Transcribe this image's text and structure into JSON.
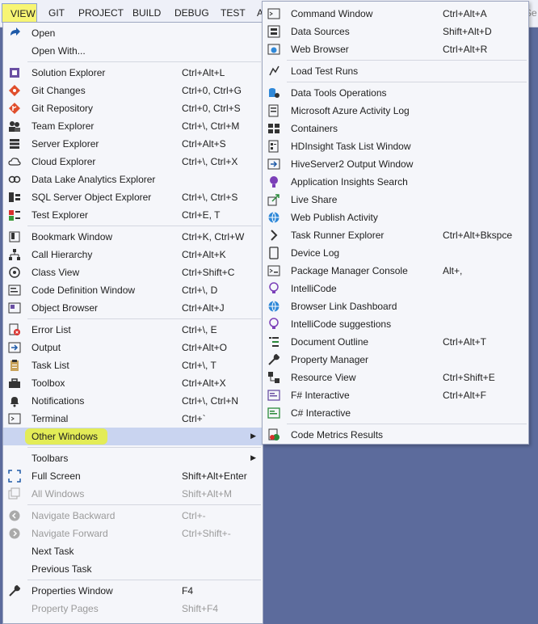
{
  "menubar": {
    "items": [
      "VIEW",
      "GIT",
      "PROJECT",
      "BUILD",
      "DEBUG",
      "TEST",
      "A"
    ],
    "search_hint": "Se"
  },
  "view_menu": {
    "items": [
      {
        "label": "Open",
        "shortcut": "",
        "icon": "open-icon"
      },
      {
        "label": "Open With...",
        "shortcut": ""
      },
      {
        "label": "Solution Explorer",
        "shortcut": "Ctrl+Alt+L",
        "icon": "solution-explorer-icon"
      },
      {
        "label": "Git Changes",
        "shortcut": "Ctrl+0, Ctrl+G",
        "icon": "git-changes-icon"
      },
      {
        "label": "Git Repository",
        "shortcut": "Ctrl+0, Ctrl+S",
        "icon": "git-repository-icon"
      },
      {
        "label": "Team Explorer",
        "shortcut": "Ctrl+\\, Ctrl+M",
        "icon": "team-explorer-icon"
      },
      {
        "label": "Server Explorer",
        "shortcut": "Ctrl+Alt+S",
        "icon": "server-explorer-icon"
      },
      {
        "label": "Cloud Explorer",
        "shortcut": "Ctrl+\\, Ctrl+X",
        "icon": "cloud-icon"
      },
      {
        "label": "Data Lake Analytics Explorer",
        "shortcut": "",
        "icon": "data-lake-icon"
      },
      {
        "label": "SQL Server Object Explorer",
        "shortcut": "Ctrl+\\, Ctrl+S",
        "icon": "sql-server-icon"
      },
      {
        "label": "Test Explorer",
        "shortcut": "Ctrl+E, T",
        "icon": "test-explorer-icon"
      },
      {
        "label": "Bookmark Window",
        "shortcut": "Ctrl+K, Ctrl+W",
        "icon": "bookmark-icon"
      },
      {
        "label": "Call Hierarchy",
        "shortcut": "Ctrl+Alt+K",
        "icon": "call-hierarchy-icon"
      },
      {
        "label": "Class View",
        "shortcut": "Ctrl+Shift+C",
        "icon": "class-view-icon"
      },
      {
        "label": "Code Definition Window",
        "shortcut": "Ctrl+\\, D",
        "icon": "code-definition-icon"
      },
      {
        "label": "Object Browser",
        "shortcut": "Ctrl+Alt+J",
        "icon": "object-browser-icon"
      },
      {
        "label": "Error List",
        "shortcut": "Ctrl+\\, E",
        "icon": "error-list-icon"
      },
      {
        "label": "Output",
        "shortcut": "Ctrl+Alt+O",
        "icon": "output-icon"
      },
      {
        "label": "Task List",
        "shortcut": "Ctrl+\\, T",
        "icon": "task-list-icon"
      },
      {
        "label": "Toolbox",
        "shortcut": "Ctrl+Alt+X",
        "icon": "toolbox-icon"
      },
      {
        "label": "Notifications",
        "shortcut": "Ctrl+\\, Ctrl+N",
        "icon": "bell-icon"
      },
      {
        "label": "Terminal",
        "shortcut": "Ctrl+`",
        "icon": "terminal-icon"
      },
      {
        "label": "Other Windows",
        "shortcut": ""
      },
      {
        "label": "Toolbars",
        "shortcut": ""
      },
      {
        "label": "Full Screen",
        "shortcut": "Shift+Alt+Enter",
        "icon": "full-screen-icon"
      },
      {
        "label": "All Windows",
        "shortcut": "Shift+Alt+M",
        "icon": "all-windows-icon"
      },
      {
        "label": "Navigate Backward",
        "shortcut": "Ctrl+-",
        "icon": "navigate-backward-icon"
      },
      {
        "label": "Navigate Forward",
        "shortcut": "Ctrl+Shift+-",
        "icon": "navigate-forward-icon"
      },
      {
        "label": "Next Task",
        "shortcut": ""
      },
      {
        "label": "Previous Task",
        "shortcut": ""
      },
      {
        "label": "Properties Window",
        "shortcut": "F4",
        "icon": "wrench-icon"
      },
      {
        "label": "Property Pages",
        "shortcut": "Shift+F4"
      }
    ]
  },
  "other_windows_menu": {
    "items": [
      {
        "label": "Command Window",
        "shortcut": "Ctrl+Alt+A",
        "icon": "command-window-icon"
      },
      {
        "label": "Data Sources",
        "shortcut": "Shift+Alt+D",
        "icon": "data-sources-icon"
      },
      {
        "label": "Web Browser",
        "shortcut": "Ctrl+Alt+R",
        "icon": "web-browser-icon"
      },
      {
        "label": "Load Test Runs",
        "shortcut": "",
        "icon": "load-test-icon"
      },
      {
        "label": "Data Tools Operations",
        "shortcut": "",
        "icon": "data-tools-icon"
      },
      {
        "label": "Microsoft Azure Activity Log",
        "shortcut": "",
        "icon": "azure-log-icon"
      },
      {
        "label": "Containers",
        "shortcut": "",
        "icon": "containers-icon"
      },
      {
        "label": "HDInsight Task List Window",
        "shortcut": "",
        "icon": "hdinsight-icon"
      },
      {
        "label": "HiveServer2 Output Window",
        "shortcut": "",
        "icon": "hiveserver-icon"
      },
      {
        "label": "Application Insights Search",
        "shortcut": "",
        "icon": "app-insights-icon"
      },
      {
        "label": "Live Share",
        "shortcut": "",
        "icon": "live-share-icon"
      },
      {
        "label": "Web Publish Activity",
        "shortcut": "",
        "icon": "globe-icon"
      },
      {
        "label": "Task Runner Explorer",
        "shortcut": "Ctrl+Alt+Bkspce",
        "icon": "chevron-right-icon"
      },
      {
        "label": "Device Log",
        "shortcut": "",
        "icon": "device-log-icon"
      },
      {
        "label": "Package Manager Console",
        "shortcut": "Alt+,",
        "icon": "package-manager-icon"
      },
      {
        "label": "IntelliCode",
        "shortcut": "",
        "icon": "intellicode-icon"
      },
      {
        "label": "Browser Link Dashboard",
        "shortcut": "",
        "icon": "browser-link-icon"
      },
      {
        "label": "IntelliCode suggestions",
        "shortcut": "",
        "icon": "intellicode-suggestions-icon"
      },
      {
        "label": "Document Outline",
        "shortcut": "Ctrl+Alt+T",
        "icon": "document-outline-icon"
      },
      {
        "label": "Property Manager",
        "shortcut": "",
        "icon": "property-manager-icon"
      },
      {
        "label": "Resource View",
        "shortcut": "Ctrl+Shift+E",
        "icon": "resource-view-icon"
      },
      {
        "label": "F# Interactive",
        "shortcut": "Ctrl+Alt+F",
        "icon": "fsharp-interactive-icon"
      },
      {
        "label": "C# Interactive",
        "shortcut": "",
        "icon": "csharp-interactive-icon"
      },
      {
        "label": "Code Metrics Results",
        "shortcut": "",
        "icon": "code-metrics-icon"
      }
    ]
  }
}
